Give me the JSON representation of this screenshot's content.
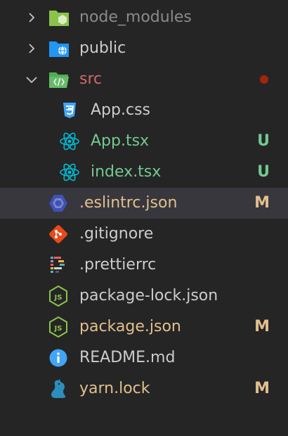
{
  "items": [
    {
      "label": "node_modules",
      "color": "#8b8b8b",
      "icon": "node-folder-icon",
      "badge": ""
    },
    {
      "label": "public",
      "color": "#cccccc",
      "icon": "globe-folder-icon",
      "badge": ""
    },
    {
      "label": "src",
      "color": "#d16969",
      "icon": "src-folder-open-icon",
      "badge": ""
    },
    {
      "label": "App.css",
      "color": "#cccccc",
      "icon": "css3-icon",
      "badge": ""
    },
    {
      "label": "App.tsx",
      "color": "#73c991",
      "icon": "react-icon",
      "badge": "U"
    },
    {
      "label": "index.tsx",
      "color": "#73c991",
      "icon": "react-icon",
      "badge": "U"
    },
    {
      "label": ".eslintrc.json",
      "color": "#e2c08d",
      "icon": "eslint-icon",
      "badge": "M"
    },
    {
      "label": ".gitignore",
      "color": "#cccccc",
      "icon": "git-icon",
      "badge": ""
    },
    {
      "label": ".prettierrc",
      "color": "#cccccc",
      "icon": "prettier-icon",
      "badge": ""
    },
    {
      "label": "package-lock.json",
      "color": "#cccccc",
      "icon": "nodejs-icon",
      "badge": ""
    },
    {
      "label": "package.json",
      "color": "#e2c08d",
      "icon": "nodejs-icon",
      "badge": "M"
    },
    {
      "label": "README.md",
      "color": "#cccccc",
      "icon": "info-icon",
      "badge": ""
    },
    {
      "label": "yarn.lock",
      "color": "#e2c08d",
      "icon": "yarn-icon",
      "badge": "M"
    }
  ],
  "colors": {
    "background": "#252526",
    "selected_row": "#37373d",
    "untracked": "#73c991",
    "modified": "#e2c08d",
    "error_dot": "#a1260d"
  }
}
